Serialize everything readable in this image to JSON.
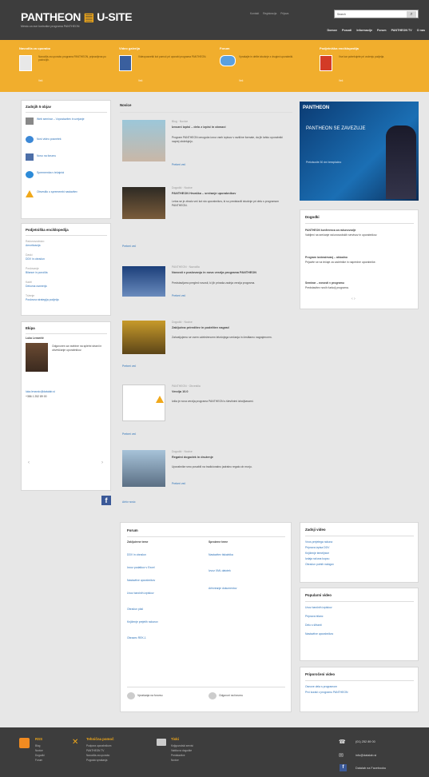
{
  "header": {
    "logo_left": "PANTHEON",
    "logo_right": "U-SITE",
    "tagline": "Mesto za sve korisnike programa PANTHEON",
    "top_links": [
      "Kontakt",
      "Registracija",
      "Prijava"
    ],
    "search_value": "Search",
    "nav": [
      "Domov",
      "Posodi",
      "Informacije",
      "Forum",
      "PANTHEON TV",
      "O nas"
    ]
  },
  "features": [
    {
      "title": "Navodila za uporabo",
      "desc": "Navodila za uporabo programa PANTHEON, pripravljena po področjih.",
      "link": "Več"
    },
    {
      "title": "Video galerija",
      "desc": "Videoposnetki kot pomoč pri uporabi programa PANTHEON.",
      "link": "Več"
    },
    {
      "title": "Forum",
      "desc": "Vprašajte in delite izkušnje z drugimi uporabniki.",
      "link": "Več"
    },
    {
      "title": "Podjetniška enciklopedija",
      "desc": "Vse kar potrebujete pri vodenju podjetja.",
      "link": "Več"
    }
  ],
  "left": {
    "last_title": "Zadnjih 5 objav",
    "last_items": [
      "Web seminar – Vzpostavitev in urejanje",
      "Novi video posnetek",
      "Novo na forumu",
      "Sprememba v tečajnici",
      "Obvestilo o spremembi nastavitev"
    ],
    "enc_title": "Podjetniška enciklopedija",
    "enc_items": [
      {
        "cat": "Računovodstvo",
        "title": "Amortizacija"
      },
      {
        "cat": "Davki",
        "title": "DDV in obračun"
      },
      {
        "cat": "Poslovanje",
        "title": "Bilance in poročila"
      },
      {
        "cat": "Kadri",
        "title": "Delovna razmerja"
      },
      {
        "cat": "Trženje",
        "title": "Poslovna strategija podjetja"
      }
    ],
    "team_title": "Ekipa",
    "person_name": "Luka Lenarčič",
    "person_desc": "Odgovoren za vsebine na spletni strani in obveščanje uporabnikov.",
    "person_contact": "luka.lenarcic@datalab.si",
    "person_phone": "+386 1 252 89 00",
    "slider_prev": "‹",
    "slider_next": "›"
  },
  "news": {
    "title": "Novice",
    "items": [
      {
        "meta": "Blog · Novice",
        "title": "Izvozni izpisi – delo z izpisi in obrazci",
        "body": "Program PANTHEON omogoča izvoz vseh izpisov v različne formate, da jih lahko uporabniki naprej obdelujejo.",
        "more": "Preberi več"
      },
      {
        "meta": "Dogodki · Novice",
        "title": "PANTHEON Hrvaška – srečanje uporabnikov",
        "body": "Letos se je zbralo več kot sto uporabnikov, ki so predstavili izkušnje pri delu s programom PANTHEON.",
        "more": "Preberi več"
      },
      {
        "meta": "PANTHEON · Navodila",
        "title": "Novosti v poslovanju in nova verzija programa PANTHEON",
        "body": "Predstavljamo pregled novosti, ki jih prinaša zadnja verzija programa.",
        "more": "Preberi več"
      },
      {
        "meta": "Dogodki · Novice",
        "title": "Zaključna prireditev in podelitev nagrad",
        "body": "Zahvaljujemo se vsem udeležencem letošnjega srečanja in čestitamo nagrajencem.",
        "more": "Preberi več"
      },
      {
        "meta": "PANTHEON · Obvestila",
        "title": "Verzija 10.0",
        "body": "Izšla je nova verzija programa PANTHEON s številnimi izboljšavami.",
        "more": "Preberi več"
      },
      {
        "meta": "Dogodki · Novice",
        "title": "Regatni dogodek in druženje",
        "body": "Uporabnike smo povabili na tradicionalno jadralno regato ob morju.",
        "more": "Preberi več"
      }
    ],
    "archive": "Arhiv novic"
  },
  "right": {
    "ad_brand": "PANTHEON",
    "ad_head": "PANTHEON SE ZAVEZUJE",
    "ad_sub": "Preizkusite 30 dni brezplačno",
    "events_title": "Dogodki",
    "events": [
      {
        "title": "PANTHEON konferenca za računovodje",
        "desc": "Vabljeni na srečanje računovodskih servisov in uporabnikov."
      },
      {
        "title": "Program izobraževanj – aktualno",
        "desc": "Prijavite se na tečaje za začetnike in napredne uporabnike."
      },
      {
        "title": "Seminar – novosti v programu",
        "desc": "Predstavitev novih funkcij programa."
      }
    ],
    "pager": "‹ ›"
  },
  "forum": {
    "title": "Forum",
    "col1_title": "Zaključene teme",
    "col2_title": "Sprožene teme",
    "col1": [
      "DDV in obračun",
      "Izvoz podatkov v Excel",
      "Nastavitve uporabnikov",
      "Uvoz bančnih izpiskov",
      "Obračun plač",
      "Knjiženje prejetih računov",
      "Obrazec REK-1"
    ],
    "col2": [
      "Nastavitev tiskalnika",
      "Izvoz XML datotek",
      "Arhiviranje dokumentov"
    ],
    "stat1": "Vprašanja na forumu",
    "stat2": "Odgovori na forumu"
  },
  "videos": {
    "last_title": "Zadnji video",
    "last": [
      "Vnos prejetega računa",
      "Priprava izpisa DDV",
      "Knjiženje temeljnice",
      "Izdaja računa kupcu",
      "Obračun potnih nalogov"
    ],
    "popular_title": "Popularni video",
    "popular": [
      "Uvoz bančnih izpiskov",
      "Priprava bilanc",
      "Delo s šifranti",
      "Nastavitve uporabnikov"
    ],
    "recommended_title": "Priporočeni video",
    "recommended": [
      "Osnove dela s programom",
      "Prvi koraki v programu PANTHEON"
    ]
  },
  "footer": {
    "col1_title": "RSS",
    "col1": [
      "Blog",
      "Novice",
      "Dogodki",
      "Forum"
    ],
    "col2_title": "Tehnična pomoč",
    "col2": [
      "Podpora uporabnikom",
      "PANTHEON TV",
      "Navodila za uporabo",
      "Pogosta vprašanja"
    ],
    "col3_title": "Tiski",
    "col3": [
      "Knjigovodski servisi",
      "Vabila na dogodke",
      "Predstavitve",
      "Novice"
    ],
    "phone": "(01) 252 89 00",
    "email": "info@datalab.si",
    "facebook": "Datalab na Facebooku"
  },
  "colors": {
    "accent": "#f1ae2d",
    "dark": "#3d3d3d",
    "link": "#2d72b8"
  }
}
